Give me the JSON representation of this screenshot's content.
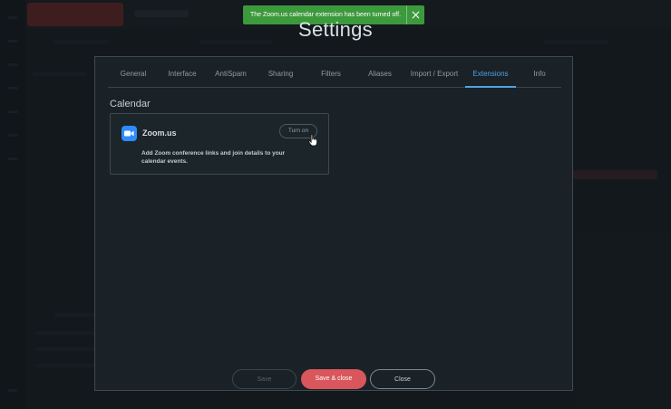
{
  "toast": {
    "message": "The Zoom.us calendar extension has been turned off.",
    "close_icon": "close-icon"
  },
  "settings": {
    "title": "Settings",
    "tabs": [
      {
        "label": "General"
      },
      {
        "label": "Interface"
      },
      {
        "label": "AntiSpam"
      },
      {
        "label": "Sharing"
      },
      {
        "label": "Filters"
      },
      {
        "label": "Aliases"
      },
      {
        "label": "Import / Export"
      },
      {
        "label": "Extensions",
        "active": true
      },
      {
        "label": "Info"
      }
    ],
    "section_title": "Calendar",
    "extension": {
      "name": "Zoom.us",
      "toggle_label": "Turn on",
      "description": "Add Zoom conference links and join details to your calendar events.",
      "icon": "zoom-video-icon",
      "brand_color": "#2d8cff"
    },
    "footer": {
      "save": "Save",
      "save_close": "Save & close",
      "close": "Close"
    }
  },
  "colors": {
    "accent": "#4ea3e6",
    "primary_button": "#d9565c",
    "toast_success": "#3c9a3c"
  }
}
